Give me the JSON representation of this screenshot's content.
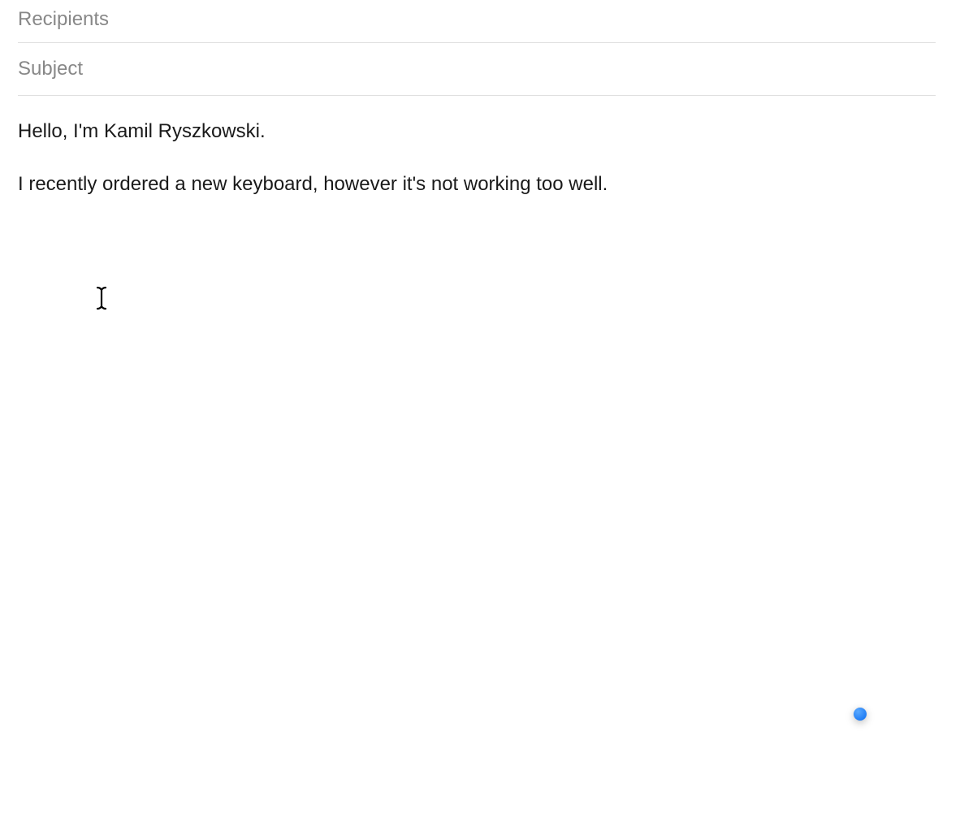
{
  "compose": {
    "recipients": {
      "placeholder": "Recipients",
      "value": ""
    },
    "subject": {
      "placeholder": "Subject",
      "value": ""
    },
    "body": "Hello, I'm Kamil Ryszkowski.\n\nI recently ordered a new keyboard, however it's not working too well."
  }
}
